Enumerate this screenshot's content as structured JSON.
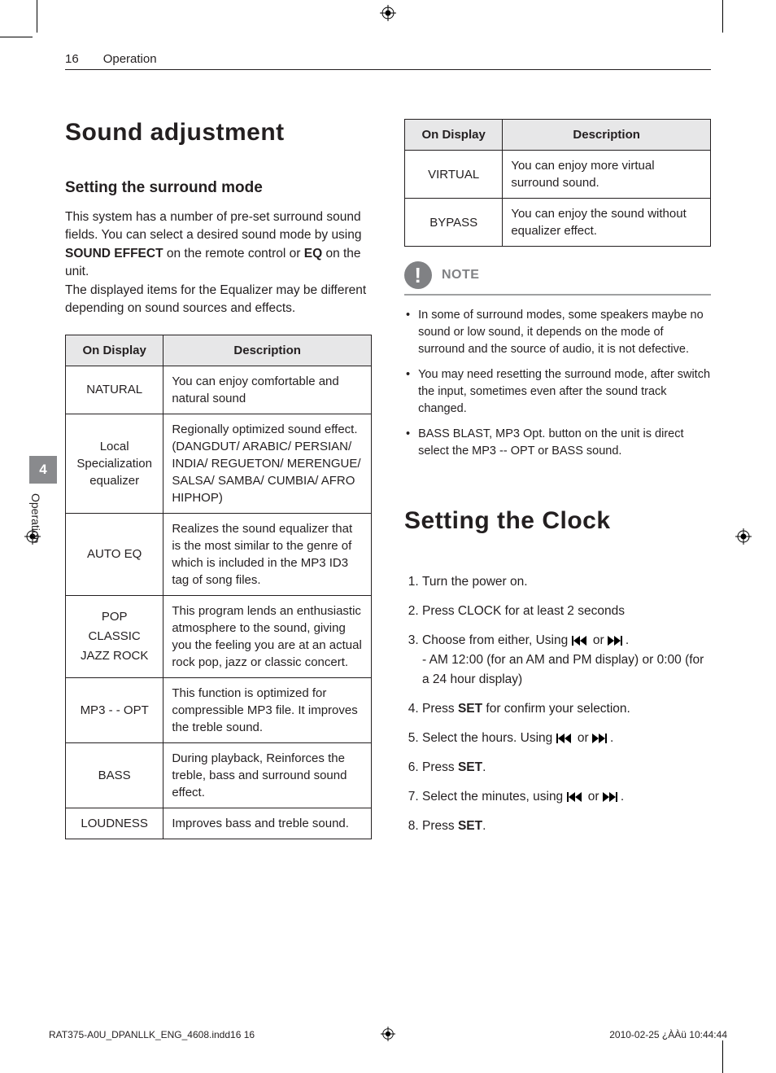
{
  "header": {
    "page_number": "16",
    "section": "Operation"
  },
  "side_tab": {
    "chapter_number": "4",
    "chapter_label": "Operation"
  },
  "h1_left": "Sound adjustment",
  "h2_surround": "Setting the surround mode",
  "intro_lines": [
    "This system has a number of pre-set surround sound fields. You can select a desired sound mode by using ",
    " on the remote control or ",
    " on the unit.",
    "The displayed items for the Equalizer may be different depending on sound sources and effects."
  ],
  "intro_bold": {
    "sound_effect": "SOUND EFFECT",
    "eq": "EQ"
  },
  "table_headers": {
    "display": "On Display",
    "desc": "Description"
  },
  "left_rows": [
    {
      "display": "NATURAL",
      "desc": "You can enjoy comfortable and natural sound"
    },
    {
      "display": "Local Specialization equalizer",
      "desc": "Regionally optimized sound effect. (DANGDUT/ ARABIC/ PERSIAN/ INDIA/ REGUETON/ MERENGUE/ SALSA/ SAMBA/ CUMBIA/ AFRO HIPHOP)"
    },
    {
      "display": "AUTO EQ",
      "desc": "Realizes the sound equalizer that is the most similar to the genre of which is included in the MP3 ID3 tag of song files."
    },
    {
      "display": "POP CLASSIC JAZZ ROCK",
      "desc": "This program lends an enthusiastic atmosphere to the sound, giving you the feeling you are at an actual rock pop, jazz or classic concert."
    },
    {
      "display": "MP3 - - OPT",
      "desc": "This function is optimized for compressible MP3 file. It improves the treble sound."
    },
    {
      "display": "BASS",
      "desc": "During playback, Reinforces the treble, bass and surround sound effect."
    },
    {
      "display": "LOUDNESS",
      "desc": "Improves bass and treble sound."
    }
  ],
  "right_rows": [
    {
      "display": "VIRTUAL",
      "desc": "You can enjoy more virtual surround sound."
    },
    {
      "display": "BYPASS",
      "desc": "You can enjoy the sound without equalizer effect."
    }
  ],
  "note_label": "NOTE",
  "notes": [
    "In some of surround modes, some speakers maybe no sound or low sound, it depends on the mode of surround and the source of audio, it is not defective.",
    "You may need resetting the surround mode, after switch the input, sometimes even after the sound track changed.",
    "BASS BLAST, MP3 Opt. button on the unit is direct select the MP3 -- OPT or BASS  sound."
  ],
  "h1_right": "Setting the Clock",
  "steps": [
    {
      "text": "Turn the power on."
    },
    {
      "text": "Press CLOCK for at least 2 seconds"
    },
    {
      "prefix": "Choose from either, Using ",
      "icons": true,
      "suffix": ".",
      "sub": "- AM 12:00 (for an AM and PM display) or 0:00 (for a 24 hour display)"
    },
    {
      "prefix": "Press ",
      "bold": "SET",
      "suffix": " for confirm your selection."
    },
    {
      "prefix": "Select the hours. Using ",
      "icons": true,
      "suffix": "."
    },
    {
      "prefix": "Press ",
      "bold": "SET",
      "suffix": "."
    },
    {
      "prefix": "Select the minutes, using ",
      "icons": true,
      "suffix": "."
    },
    {
      "prefix": "Press ",
      "bold": "SET",
      "suffix": "."
    }
  ],
  "footer": {
    "left": "RAT375-A0U_DPANLLK_ENG_4608.indd16   16",
    "right": "2010-02-25   ¿ÀÀü 10:44:44"
  },
  "skip_or": " or "
}
